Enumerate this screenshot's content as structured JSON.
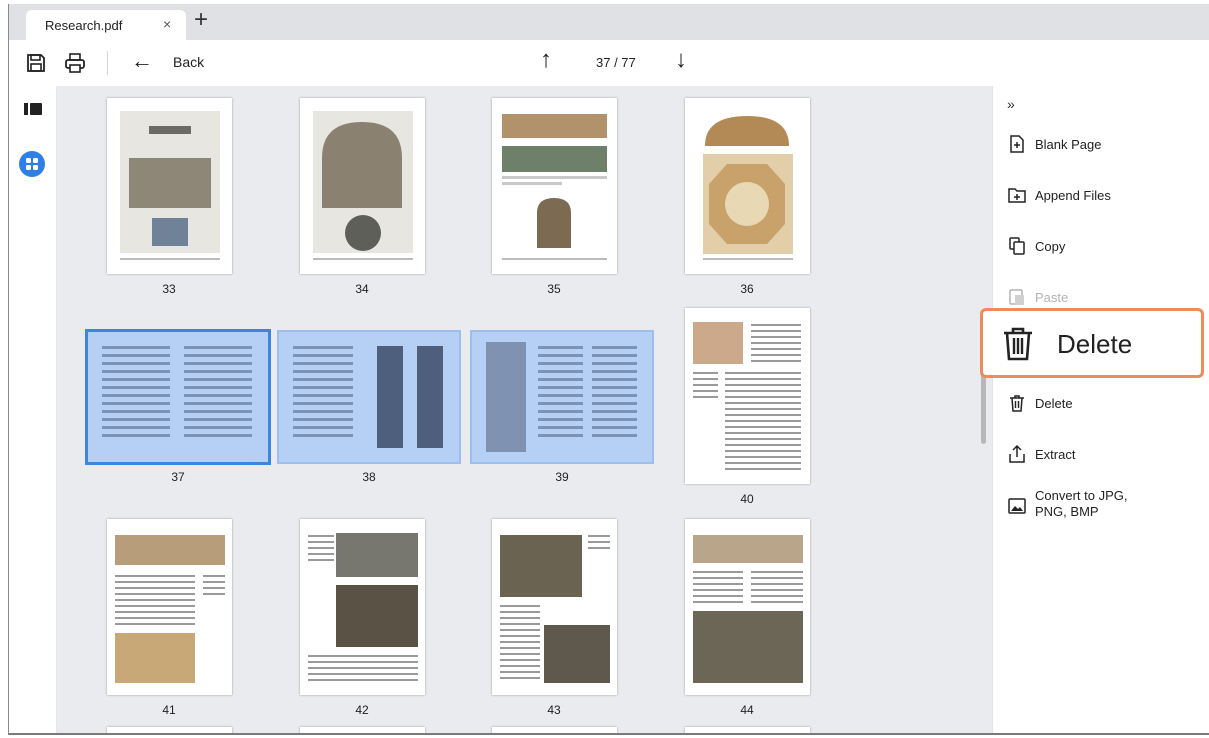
{
  "tab": {
    "title": "Research.pdf",
    "close": "×",
    "new": "+"
  },
  "toolbar": {
    "back_label": "Back",
    "page_indicator": "37 / 77"
  },
  "icons": {
    "save": "save-icon",
    "print": "print-icon",
    "back": "arrow-left-icon",
    "prev": "arrow-up-icon",
    "next": "arrow-down-icon",
    "sidebar": "sidebar-toggle-icon",
    "grid": "grid-view-icon"
  },
  "thumbnails": {
    "row1": [
      "33",
      "34",
      "35",
      "36"
    ],
    "row2": [
      "37",
      "38",
      "39",
      "40"
    ],
    "row3": [
      "41",
      "42",
      "43",
      "44"
    ],
    "selected_pages": [
      "37",
      "38",
      "39"
    ],
    "active_page": "37"
  },
  "panel": {
    "collapse": "»",
    "items": [
      {
        "label": "Blank Page",
        "icon": "blank-page-icon",
        "enabled": true
      },
      {
        "label": "Append Files",
        "icon": "append-files-icon",
        "enabled": true
      },
      {
        "label": "Copy",
        "icon": "copy-icon",
        "enabled": true
      },
      {
        "label": "Paste",
        "icon": "paste-icon",
        "enabled": false
      },
      {
        "label": "Delete",
        "icon": "trash-icon",
        "enabled": true
      },
      {
        "label": "Delete",
        "icon": "trash-icon",
        "enabled": true
      },
      {
        "label": "Extract",
        "icon": "extract-icon",
        "enabled": true
      },
      {
        "label": "Convert to JPG,",
        "label_line2": "PNG, BMP",
        "icon": "image-icon",
        "enabled": true
      }
    ]
  },
  "colors": {
    "accent": "#3b86e0",
    "selection": "#b6cff4",
    "callout": "#ef8a5b",
    "grid_bg": "#e9ebee",
    "tabstrip": "#dfe1e5"
  }
}
